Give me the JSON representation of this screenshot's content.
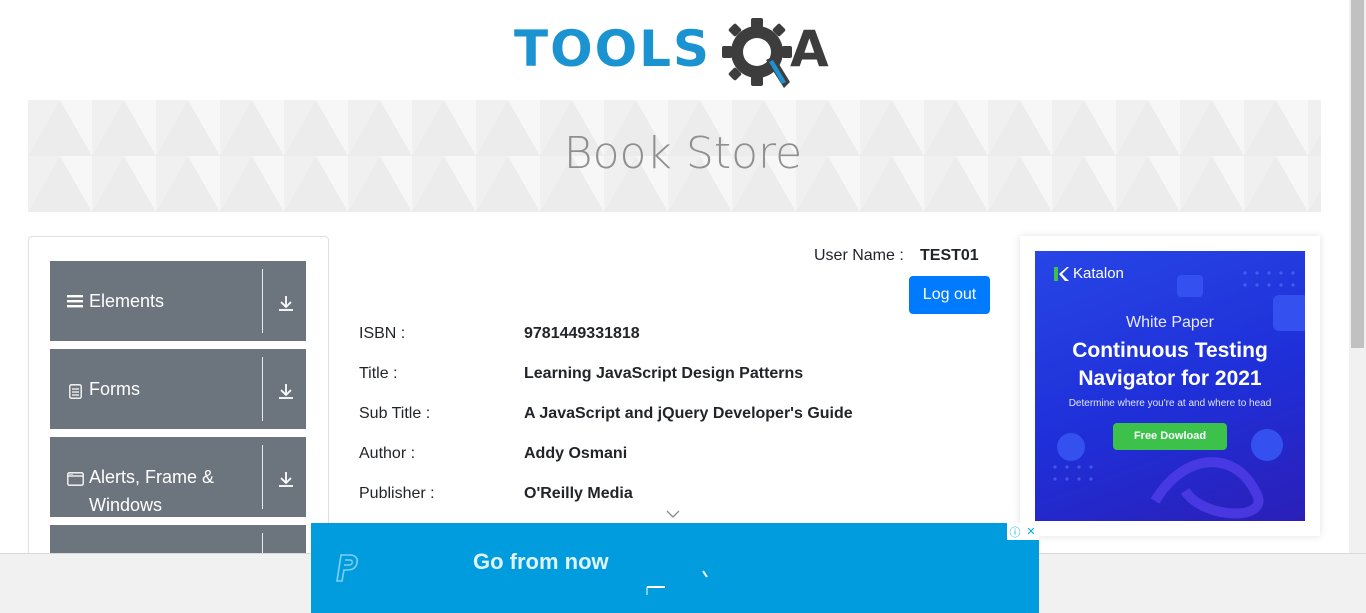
{
  "logo": {
    "part1": "TOOLS",
    "part2": "A"
  },
  "banner": {
    "title": "Book Store"
  },
  "sidebar": {
    "groups": [
      {
        "label": "Elements",
        "icon": "hamburger-icon"
      },
      {
        "label": "Forms",
        "icon": "document-icon"
      },
      {
        "label": "Alerts, Frame & Windows",
        "icon": "window-icon"
      },
      {
        "label": "",
        "icon": ""
      }
    ]
  },
  "profile": {
    "user_label": "User Name :",
    "user_value": "TEST01",
    "logout_label": "Log out",
    "fields": [
      {
        "label": "ISBN :",
        "value": "9781449331818"
      },
      {
        "label": "Title :",
        "value": "Learning JavaScript Design Patterns"
      },
      {
        "label": "Sub Title :",
        "value": "A JavaScript and jQuery Developer's Guide"
      },
      {
        "label": "Author :",
        "value": "Addy Osmani"
      },
      {
        "label": "Publisher :",
        "value": "O'Reilly Media"
      }
    ]
  },
  "ad_right": {
    "brand": "Katalon",
    "kicker": "White Paper",
    "headline_1": "Continuous Testing",
    "headline_2": "Navigator for 2021",
    "sub": "Determine where you're at and where to head",
    "cta": "Free Dowload"
  },
  "ad_bottom": {
    "text": "Go from now"
  },
  "colors": {
    "brand_blue": "#1b93d1",
    "button_blue": "#007bff",
    "sidebar_gray": "#6c757d"
  }
}
